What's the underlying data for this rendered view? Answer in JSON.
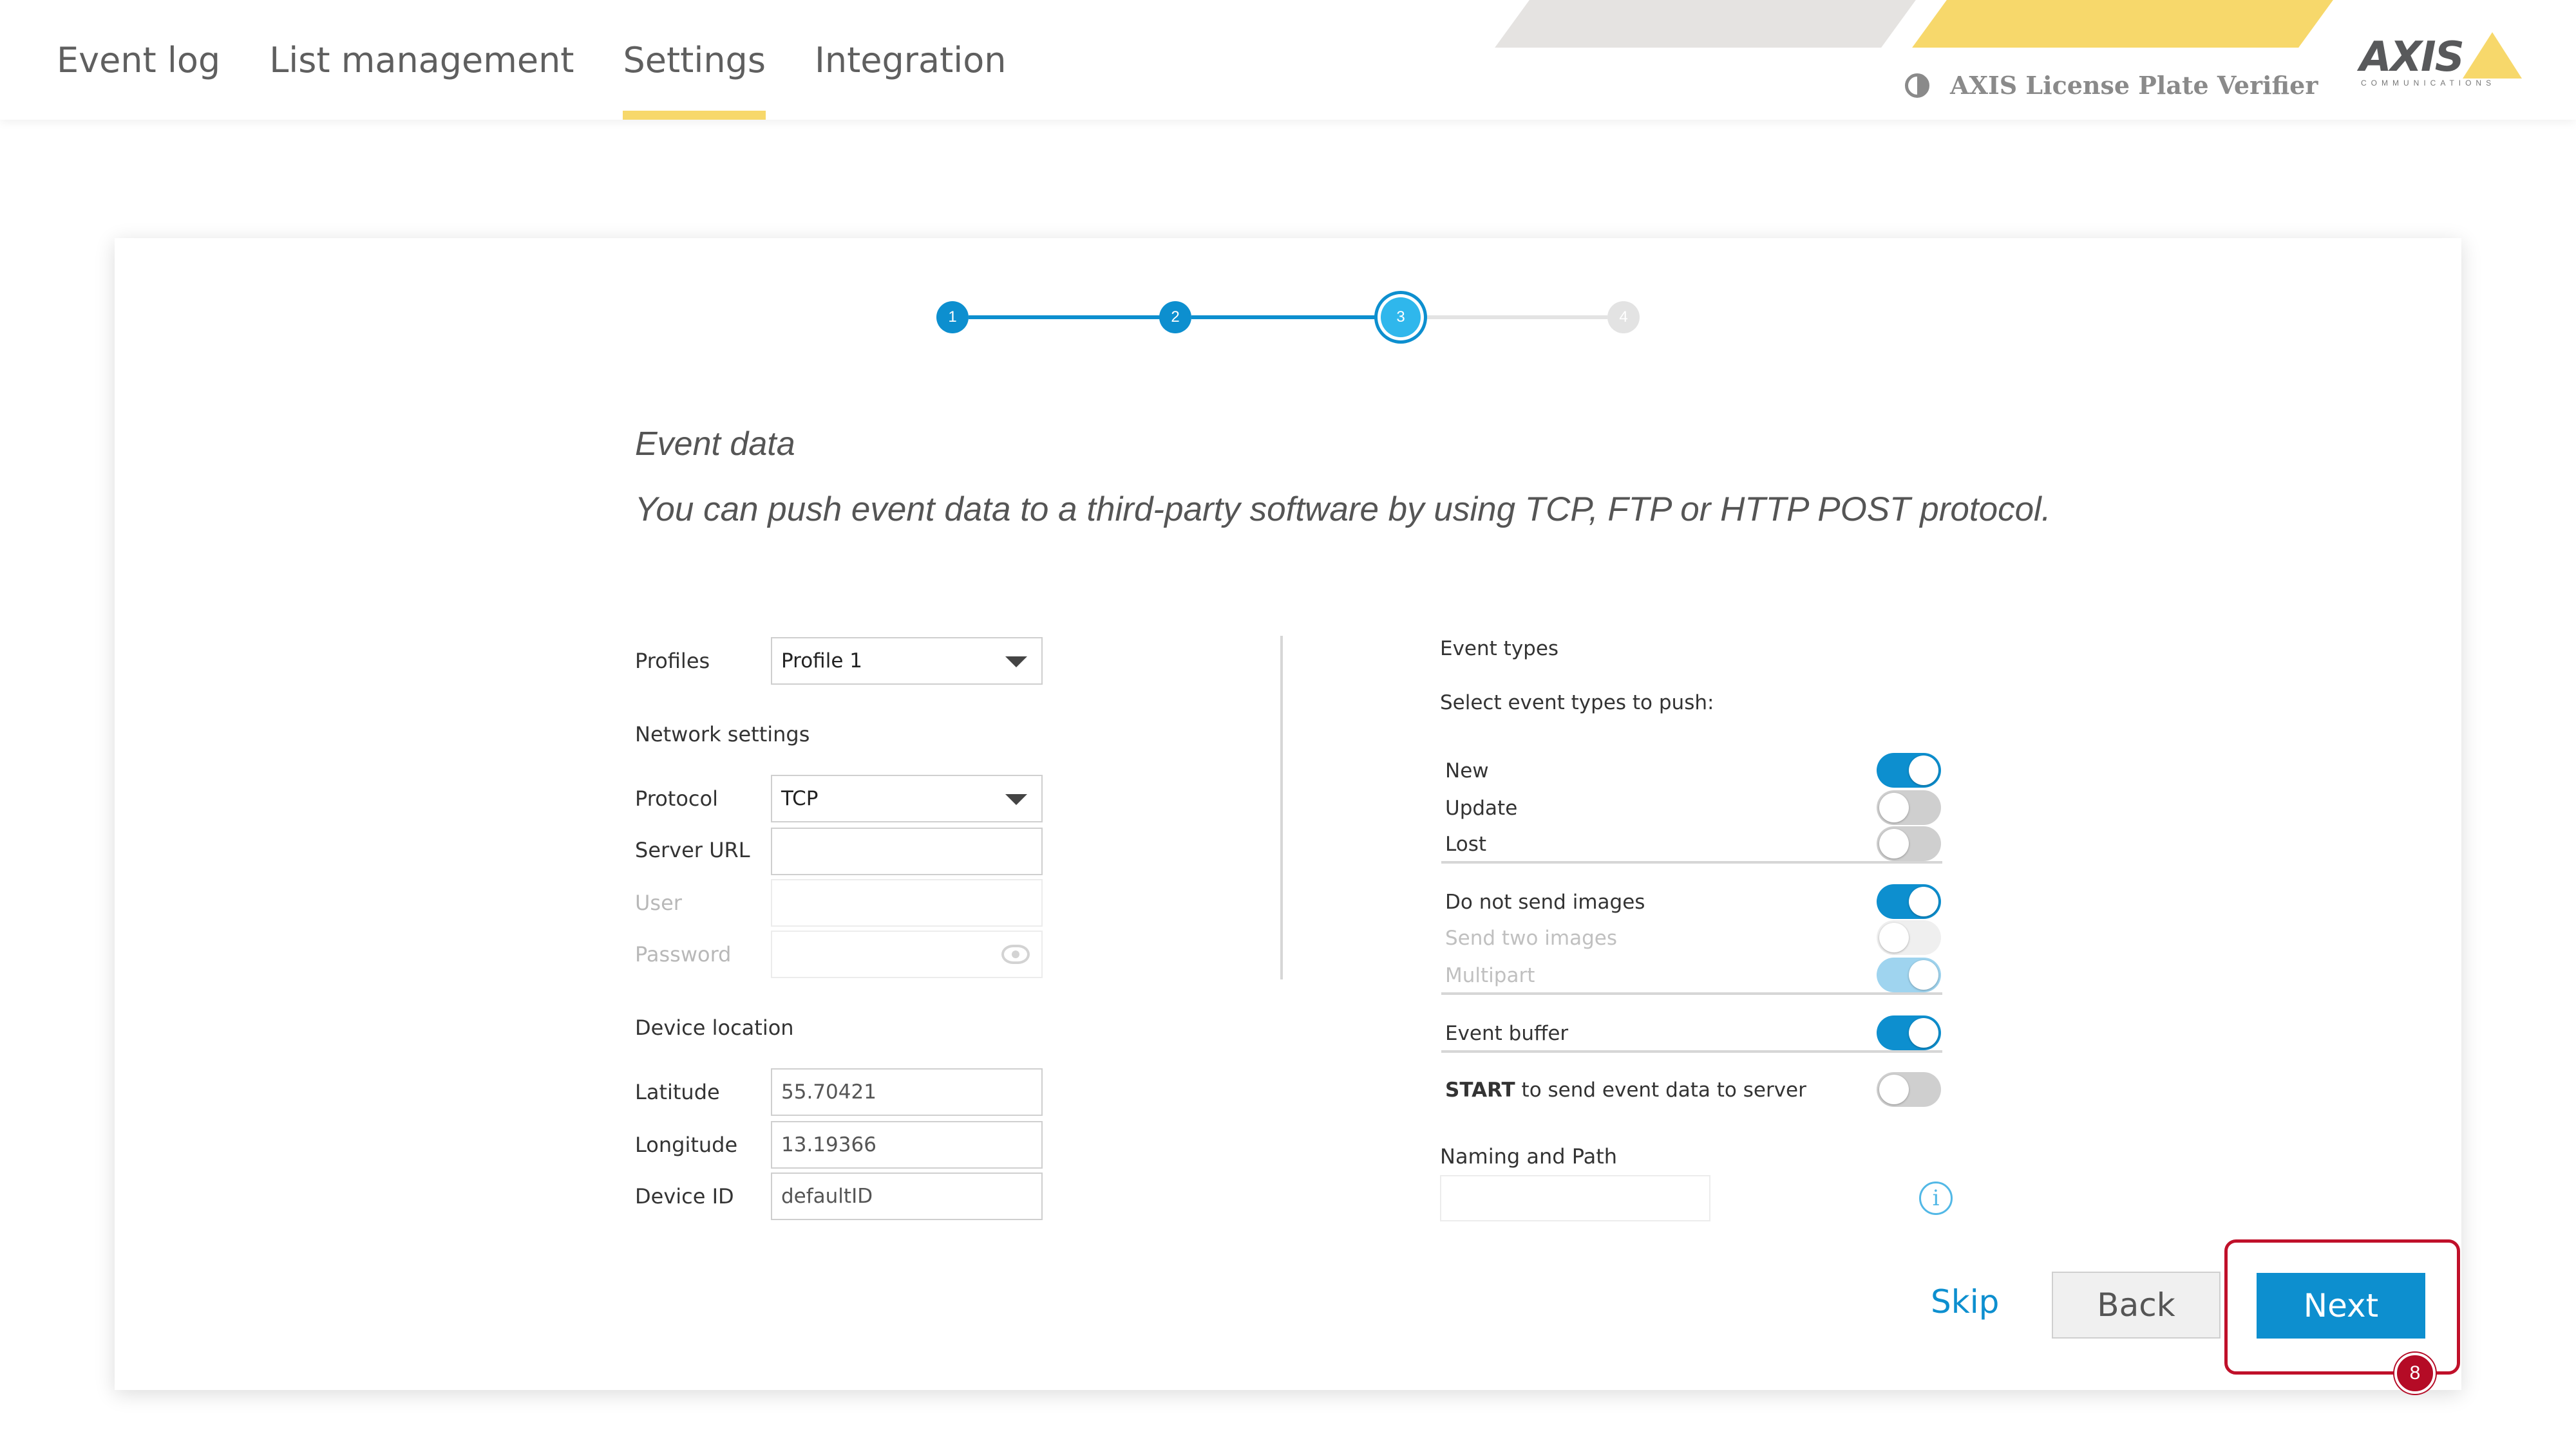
{
  "nav": {
    "tabs": [
      {
        "label": "Event log",
        "active": false
      },
      {
        "label": "List management",
        "active": false
      },
      {
        "label": "Settings",
        "active": true
      },
      {
        "label": "Integration",
        "active": false
      }
    ],
    "product_name": "AXIS License Plate Verifier",
    "product_icon": "contrast-icon",
    "logo_text": "AXIS",
    "logo_subtext": "COMMUNICATIONS"
  },
  "stepper": {
    "steps": [
      "1",
      "2",
      "3",
      "4"
    ],
    "current": 3,
    "active_color": "#0d8fcf",
    "inactive_color": "#e3e3e3"
  },
  "wizard": {
    "title": "Event data",
    "description": "You can push event data to a third-party software by using TCP, FTP or HTTP POST protocol."
  },
  "form": {
    "profiles_label": "Profiles",
    "profile_value": "Profile 1",
    "network_section": "Network settings",
    "protocol_label": "Protocol",
    "protocol_value": "TCP",
    "server_url_label": "Server URL",
    "server_url_value": "",
    "user_label": "User",
    "user_value": "",
    "password_label": "Password",
    "password_value": "",
    "location_section": "Device location",
    "latitude_label": "Latitude",
    "latitude_value": "55.70421",
    "longitude_label": "Longitude",
    "longitude_value": "13.19366",
    "device_id_label": "Device ID",
    "device_id_value": "defaultID"
  },
  "events": {
    "title": "Event types",
    "subtitle": "Select event types to push:",
    "toggles": [
      {
        "label": "New",
        "on": true,
        "enabled": true
      },
      {
        "label": "Update",
        "on": false,
        "enabled": true
      },
      {
        "label": "Lost",
        "on": false,
        "enabled": true
      },
      {
        "label": "Do not send images",
        "on": true,
        "enabled": true
      },
      {
        "label": "Send two images",
        "on": false,
        "enabled": false
      },
      {
        "label": "Multipart",
        "on": true,
        "enabled": false
      },
      {
        "label": "Event buffer",
        "on": true,
        "enabled": true
      }
    ],
    "start_bold": "START",
    "start_rest": " to send event data to server",
    "start_on": false,
    "naming_label": "Naming and Path",
    "naming_value": ""
  },
  "buttons": {
    "skip": "Skip",
    "back": "Back",
    "next": "Next"
  },
  "annotation": {
    "badge": "8",
    "color": "#c0102a"
  }
}
